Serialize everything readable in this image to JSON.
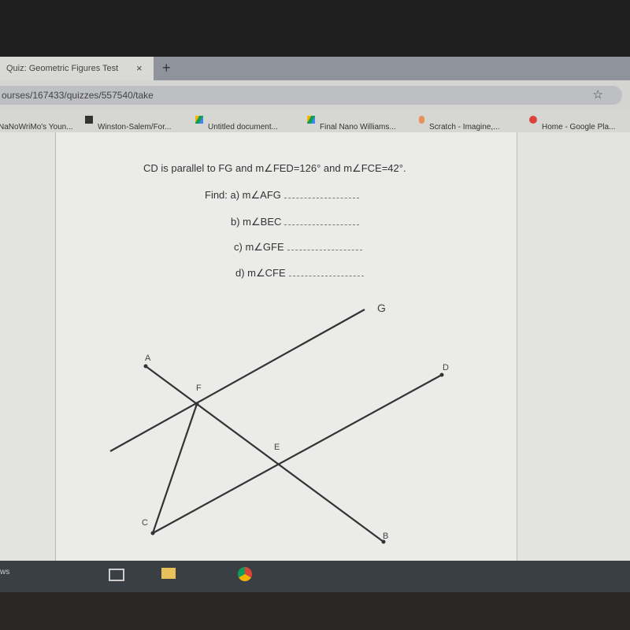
{
  "browser": {
    "tab_title": "Quiz: Geometric Figures Test",
    "tab_close": "×",
    "new_tab": "+",
    "url": "ourses/167433/quizzes/557540/take",
    "star": "☆",
    "bookmarks": [
      {
        "label": "NaNoWriMo's Youn...",
        "icon": "page-icon"
      },
      {
        "label": "Winston-Salem/For...",
        "icon": "square-icon"
      },
      {
        "label": "Untitled document...",
        "icon": "drive-icon"
      },
      {
        "label": "Final Nano Williams...",
        "icon": "drive-icon"
      },
      {
        "label": "Scratch - Imagine,...",
        "icon": "scratch-icon"
      },
      {
        "label": "Home - Google Pla...",
        "icon": "google-play-icon"
      }
    ]
  },
  "question": {
    "prompt": "CD is parallel to FG and m∠FED=126° and m∠FCE=42°.",
    "items": [
      "Find: a)  m∠AFG",
      "b) m∠BEC",
      "c) m∠GFE",
      "d) m∠CFE"
    ]
  },
  "figure": {
    "labels": {
      "G": "G",
      "A": "A",
      "D": "D",
      "F": "F",
      "E": "E",
      "C": "C",
      "B": "B"
    }
  },
  "taskbar": {
    "text": "ws"
  }
}
